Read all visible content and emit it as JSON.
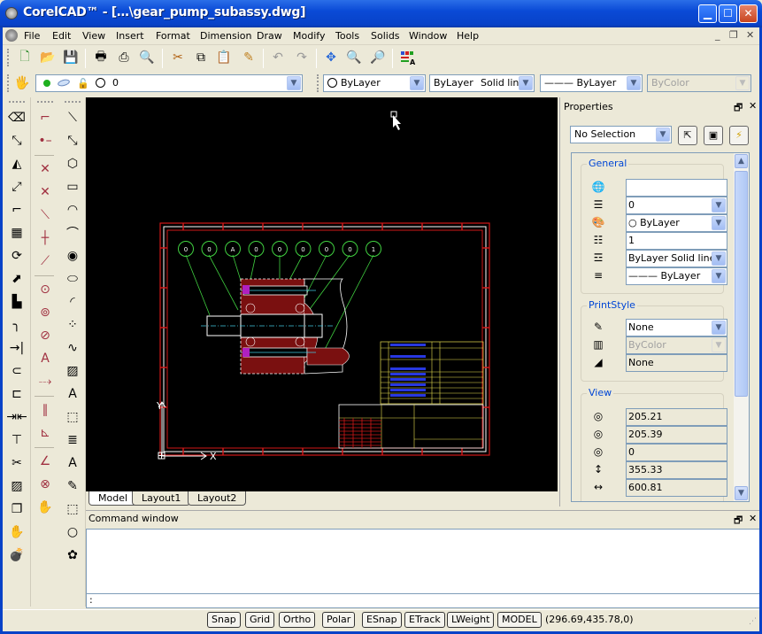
{
  "window": {
    "title": "CorelCAD™ - […\\gear_pump_subassy.dwg]",
    "minimize": "_",
    "maximize": "□",
    "close": "✕"
  },
  "menu": {
    "items": [
      "File",
      "Edit",
      "View",
      "Insert",
      "Format",
      "Dimension",
      "Draw",
      "Modify",
      "Tools",
      "Solids",
      "Window",
      "Help"
    ],
    "mdi_controls": [
      "_",
      "🗗",
      "✕"
    ]
  },
  "toolbar_standard": {
    "buttons": [
      {
        "name": "new-icon",
        "glyph": "🗋"
      },
      {
        "name": "open-icon",
        "glyph": "📂"
      },
      {
        "name": "save-icon",
        "glyph": "💾"
      },
      {
        "name": "print-icon",
        "glyph": "🖶"
      },
      {
        "name": "plot-icon",
        "glyph": "⎙"
      },
      {
        "name": "print-preview-icon",
        "glyph": "🔍"
      },
      {
        "name": "cut-icon",
        "glyph": "✂"
      },
      {
        "name": "copy-icon",
        "glyph": "⧉"
      },
      {
        "name": "paste-icon",
        "glyph": "📋"
      },
      {
        "name": "match-properties-icon",
        "glyph": "✎"
      },
      {
        "name": "undo-icon",
        "glyph": "↶"
      },
      {
        "name": "redo-icon",
        "glyph": "↷"
      },
      {
        "name": "pan-icon",
        "glyph": "✥"
      },
      {
        "name": "zoom-realtime-icon",
        "glyph": "🔍"
      },
      {
        "name": "zoom-previous-icon",
        "glyph": "🔎"
      },
      {
        "name": "layer-manager-icon",
        "glyph": "▦"
      }
    ]
  },
  "toolbar_properties": {
    "layer_value": "0",
    "color_value": "ByLayer",
    "linetype_value": "ByLayer",
    "linetype_style": "Solid line",
    "lineweight_value": "——— ByLayer",
    "printstyle_value": "ByColor"
  },
  "left_toolbars": {
    "col1": [
      "eraser",
      "stretch",
      "mirror",
      "scale",
      "offset",
      "array",
      "rotate",
      "resize",
      "explode",
      "fillet",
      "extend",
      "chamfer-round",
      "chamfer",
      "break",
      "trim",
      "scissors",
      "hatch-edit",
      "copy",
      "edit-hand",
      "bomb"
    ],
    "col2": [
      "snap-endpoint",
      "snap-midpoint",
      "snap-intersection",
      "snap-apparent",
      "snap-nearest",
      "snap-perpendicular",
      "snap-tangent",
      "snap-center",
      "snap-quadrant",
      "snap-node",
      "snap-insertion",
      "snap-extension",
      "snap-parallel",
      "snap-perp2",
      "snap-angle",
      "clear-snaps",
      "snap-settings"
    ],
    "col3": [
      "line",
      "infinite-line",
      "polygon",
      "rectangle",
      "arc",
      "arc2",
      "circle",
      "ellipse",
      "ellipse-arc",
      "points",
      "spline",
      "hatch",
      "attribute",
      "block",
      "note",
      "text",
      "revcloud-edit",
      "revcloud",
      "cloud",
      "cloud2"
    ]
  },
  "drawing_tabs": [
    "Model",
    "Layout1",
    "Layout2"
  ],
  "active_tab": "Model",
  "balloons": [
    "0",
    "0",
    "A",
    "0",
    "0",
    "0",
    "0",
    "0",
    "1"
  ],
  "ucs": {
    "x": "X",
    "y": "Y"
  },
  "properties": {
    "title": "Properties",
    "selection": "No Selection",
    "general": {
      "label": "General",
      "rows": [
        {
          "icon": "hyperlink-icon",
          "value": "",
          "type": "text"
        },
        {
          "icon": "layer-icon",
          "value": "0",
          "type": "combo"
        },
        {
          "icon": "color-icon",
          "value": "○ ByLayer",
          "type": "combo"
        },
        {
          "icon": "linetype-scale-icon",
          "value": "1",
          "type": "text"
        },
        {
          "icon": "linetype-icon",
          "value": "ByLayer     Solid line",
          "type": "combo"
        },
        {
          "icon": "lineweight-icon",
          "value": "——— ByLayer",
          "type": "combo"
        }
      ]
    },
    "printstyle": {
      "label": "PrintStyle",
      "rows": [
        {
          "icon": "print-style-icon",
          "value": "None",
          "type": "combo"
        },
        {
          "icon": "print-table-icon",
          "value": "ByColor",
          "type": "disabled"
        },
        {
          "icon": "print-table-type-icon",
          "value": "None",
          "type": "readonly"
        }
      ]
    },
    "view": {
      "label": "View",
      "rows": [
        {
          "icon": "center-x-icon",
          "value": "205.21"
        },
        {
          "icon": "center-y-icon",
          "value": "205.39"
        },
        {
          "icon": "center-z-icon",
          "value": "0"
        },
        {
          "icon": "height-icon",
          "value": "355.33"
        },
        {
          "icon": "width-icon",
          "value": "600.81"
        }
      ]
    }
  },
  "command": {
    "title": "Command window",
    "prompt": ":"
  },
  "status": {
    "buttons": [
      "Snap",
      "Grid",
      "Ortho",
      "Polar",
      "ESnap",
      "ETrack",
      "LWeight",
      "MODEL"
    ],
    "coords": "(296.69,435.78,0)"
  }
}
